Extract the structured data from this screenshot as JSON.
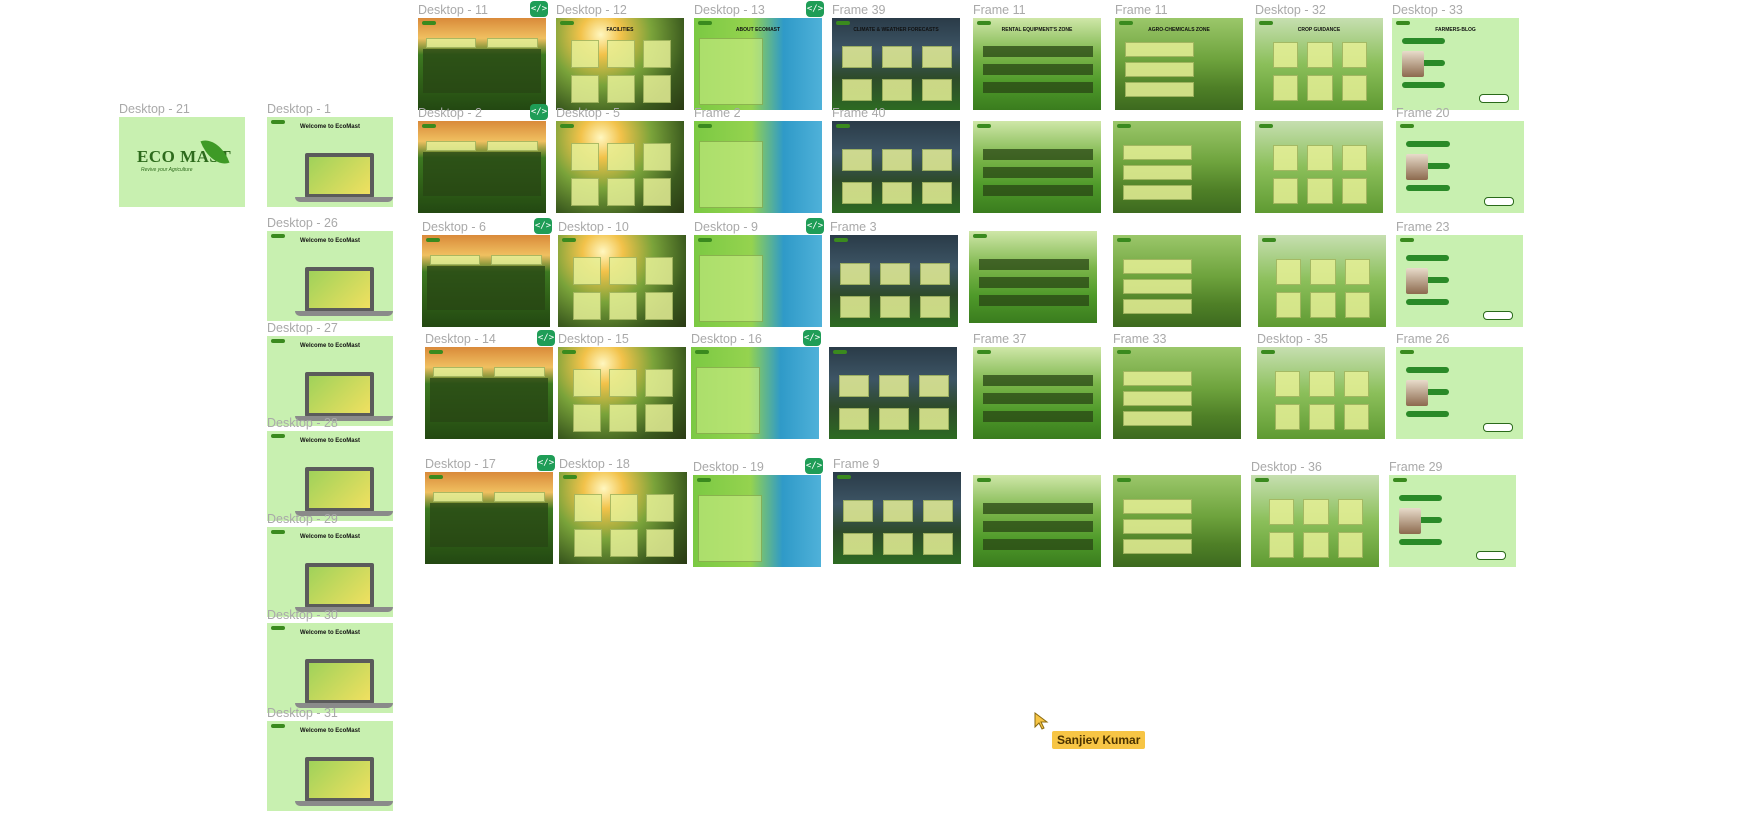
{
  "canvas": {
    "background": "#ffffff"
  },
  "colors": {
    "label": "#a9a9a9",
    "badge": "#1f9d57",
    "user_tag_bg": "#f7c545",
    "frame_green": "#c8f0b0"
  },
  "logo": {
    "brand": "ECO MAST",
    "tagline": "Revive your Agriculture"
  },
  "welcome_title": "Welcome to EcoMast",
  "frames": [
    {
      "id": "desktop-21",
      "label": "Desktop - 21",
      "theme": "logo"
    },
    {
      "id": "desktop-1",
      "label": "Desktop - 1",
      "theme": "welcome"
    },
    {
      "id": "desktop-26",
      "label": "Desktop - 26",
      "theme": "welcome"
    },
    {
      "id": "desktop-27",
      "label": "Desktop - 27",
      "theme": "welcome"
    },
    {
      "id": "desktop-28",
      "label": "Desktop - 28",
      "theme": "welcome"
    },
    {
      "id": "desktop-29",
      "label": "Desktop - 29",
      "theme": "welcome"
    },
    {
      "id": "desktop-30",
      "label": "Desktop - 30",
      "theme": "welcome"
    },
    {
      "id": "desktop-31",
      "label": "Desktop - 31",
      "theme": "welcome"
    },
    {
      "id": "desktop-11",
      "label": "Desktop - 11",
      "theme": "field",
      "badge": true
    },
    {
      "id": "desktop-12",
      "label": "Desktop - 12",
      "theme": "sun",
      "title": "FACILITIES"
    },
    {
      "id": "desktop-13",
      "label": "Desktop - 13",
      "theme": "farmer",
      "badge": true,
      "title": "ABOUT ECOMAST"
    },
    {
      "id": "frame-39",
      "label": "Frame 39",
      "theme": "storm",
      "title": "CLIMATE & WEATHER FORECASTS"
    },
    {
      "id": "frame-11a",
      "label": "Frame 11",
      "theme": "green",
      "title": "RENTAL EQUIPMENT'S ZONE"
    },
    {
      "id": "frame-11b",
      "label": "Frame 11",
      "theme": "tractor",
      "title": "AGRO-CHEMICALS ZONE"
    },
    {
      "id": "desktop-32",
      "label": "Desktop - 32",
      "theme": "crop",
      "title": "CROP GUIDANCE"
    },
    {
      "id": "desktop-33",
      "label": "Desktop - 33",
      "theme": "blog",
      "title": "FARMERS-BLOG"
    },
    {
      "id": "desktop-2",
      "label": "Desktop - 2",
      "theme": "field",
      "badge": true
    },
    {
      "id": "desktop-5",
      "label": "Desktop - 5",
      "theme": "sun"
    },
    {
      "id": "frame-2",
      "label": "Frame 2",
      "theme": "farmer"
    },
    {
      "id": "frame-40",
      "label": "Frame 40",
      "theme": "storm"
    },
    {
      "id": "frame-r2-5",
      "label": "",
      "theme": "green"
    },
    {
      "id": "frame-r2-6",
      "label": "",
      "theme": "tractor"
    },
    {
      "id": "frame-r2-7",
      "label": "",
      "theme": "crop"
    },
    {
      "id": "frame-20",
      "label": "Frame 20",
      "theme": "blog"
    },
    {
      "id": "desktop-6",
      "label": "Desktop - 6",
      "theme": "field",
      "badge": true
    },
    {
      "id": "desktop-10",
      "label": "Desktop - 10",
      "theme": "sun"
    },
    {
      "id": "desktop-9",
      "label": "Desktop - 9",
      "theme": "farmer",
      "badge": true
    },
    {
      "id": "frame-3",
      "label": "Frame 3",
      "theme": "storm"
    },
    {
      "id": "frame-r3-5",
      "label": "",
      "theme": "green"
    },
    {
      "id": "frame-r3-6",
      "label": "",
      "theme": "tractor"
    },
    {
      "id": "frame-r3-7",
      "label": "",
      "theme": "crop"
    },
    {
      "id": "frame-23",
      "label": "Frame 23",
      "theme": "blog"
    },
    {
      "id": "desktop-14",
      "label": "Desktop - 14",
      "theme": "field",
      "badge": true
    },
    {
      "id": "desktop-15",
      "label": "Desktop - 15",
      "theme": "sun"
    },
    {
      "id": "desktop-16",
      "label": "Desktop - 16",
      "theme": "farmer",
      "badge": true
    },
    {
      "id": "frame-r4-4",
      "label": "",
      "theme": "storm"
    },
    {
      "id": "frame-37",
      "label": "Frame 37",
      "theme": "green"
    },
    {
      "id": "frame-33",
      "label": "Frame 33",
      "theme": "tractor"
    },
    {
      "id": "desktop-35",
      "label": "Desktop - 35",
      "theme": "crop"
    },
    {
      "id": "frame-26",
      "label": "Frame 26",
      "theme": "blog"
    },
    {
      "id": "desktop-17",
      "label": "Desktop - 17",
      "theme": "field",
      "badge": true
    },
    {
      "id": "desktop-18",
      "label": "Desktop - 18",
      "theme": "sun"
    },
    {
      "id": "desktop-19",
      "label": "Desktop - 19",
      "theme": "farmer",
      "badge": true
    },
    {
      "id": "frame-9",
      "label": "Frame 9",
      "theme": "storm"
    },
    {
      "id": "frame-r5-5",
      "label": "",
      "theme": "green"
    },
    {
      "id": "frame-r5-6",
      "label": "",
      "theme": "tractor"
    },
    {
      "id": "desktop-36",
      "label": "Desktop - 36",
      "theme": "crop"
    },
    {
      "id": "frame-29",
      "label": "Frame 29",
      "theme": "blog"
    }
  ],
  "collaborator": {
    "name": "Sanjiev Kumar"
  }
}
